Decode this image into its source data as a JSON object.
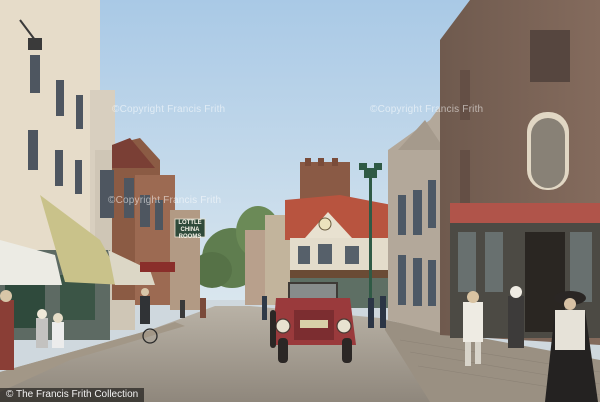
{
  "photo": {
    "subject": "Hand-coloured historic street scene with vintage automobile",
    "colors": {
      "sky": "#bcd6ec",
      "road": "#a59d92",
      "brick": "#8a5a45",
      "car": "#9a3a3c",
      "awning": "#c9c28a"
    }
  },
  "watermarks": [
    "©Copyright Francis Frith",
    "©Copyright Francis Frith",
    "©Copyright Francis Frith"
  ],
  "shop_sign": {
    "line1": "LOTTLE",
    "line2": "CHINA",
    "line3": "ROOMS"
  },
  "credit": "© The Francis Frith Collection"
}
